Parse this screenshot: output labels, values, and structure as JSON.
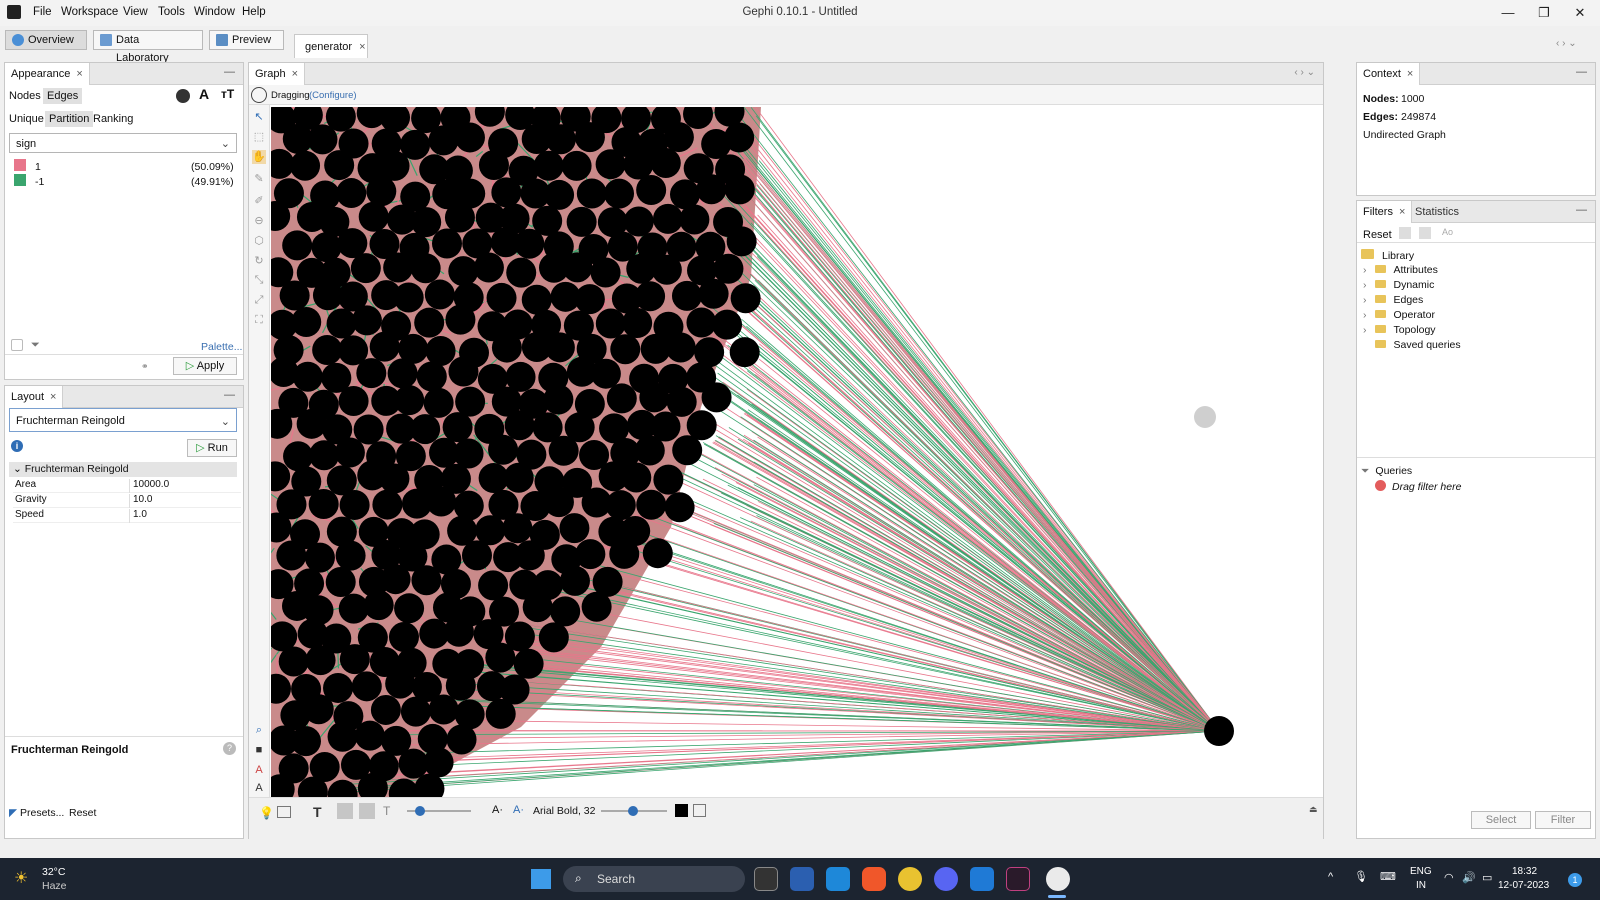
{
  "window": {
    "title": "Gephi 0.10.1 - Untitled"
  },
  "menu": [
    "File",
    "Workspace",
    "View",
    "Tools",
    "Window",
    "Help"
  ],
  "toolbar": {
    "overview": "Overview",
    "data_laboratory": "Data Laboratory",
    "preview": "Preview",
    "workspace_tab": "generator"
  },
  "appearance": {
    "tab": "Appearance",
    "nodes": "Nodes",
    "edges": "Edges",
    "modes": [
      "Unique",
      "Partition",
      "Ranking"
    ],
    "attribute": "sign",
    "partitions": [
      {
        "label": "1",
        "pct": "(50.09%)",
        "color": "#e8768b"
      },
      {
        "label": "-1",
        "pct": "(49.91%)",
        "color": "#3aa56e"
      }
    ],
    "palette": "Palette...",
    "apply": "Apply"
  },
  "layout": {
    "tab": "Layout",
    "algorithm": "Fruchterman Reingold",
    "run": "Run",
    "section": "Fruchterman Reingold",
    "props": [
      {
        "k": "Area",
        "v": "10000.0"
      },
      {
        "k": "Gravity",
        "v": "10.0"
      },
      {
        "k": "Speed",
        "v": "1.0"
      }
    ],
    "desc_title": "Fruchterman Reingold",
    "presets": "Presets...",
    "reset": "Reset"
  },
  "graph": {
    "tab": "Graph",
    "mode": "Dragging",
    "configure": "(Configure)",
    "font": "Arial Bold, 32",
    "colors": {
      "positive": "#e8768b",
      "negative": "#3aa56e",
      "node": "#000000"
    }
  },
  "context": {
    "tab": "Context",
    "nodes_label": "Nodes:",
    "nodes": "1000",
    "edges_label": "Edges:",
    "edges": "249874",
    "type": "Undirected Graph"
  },
  "filters": {
    "tab": "Filters",
    "statistics": "Statistics",
    "reset": "Reset",
    "library": "Library",
    "items": [
      "Attributes",
      "Dynamic",
      "Edges",
      "Operator",
      "Topology",
      "Saved queries"
    ],
    "queries": "Queries",
    "drag": "Drag filter here",
    "select": "Select",
    "filter": "Filter"
  },
  "taskbar": {
    "temp": "32°C",
    "weather": "Haze",
    "search": "Search",
    "lang1": "ENG",
    "lang2": "IN",
    "time": "18:32",
    "date": "12-07-2023",
    "badge": "1"
  }
}
